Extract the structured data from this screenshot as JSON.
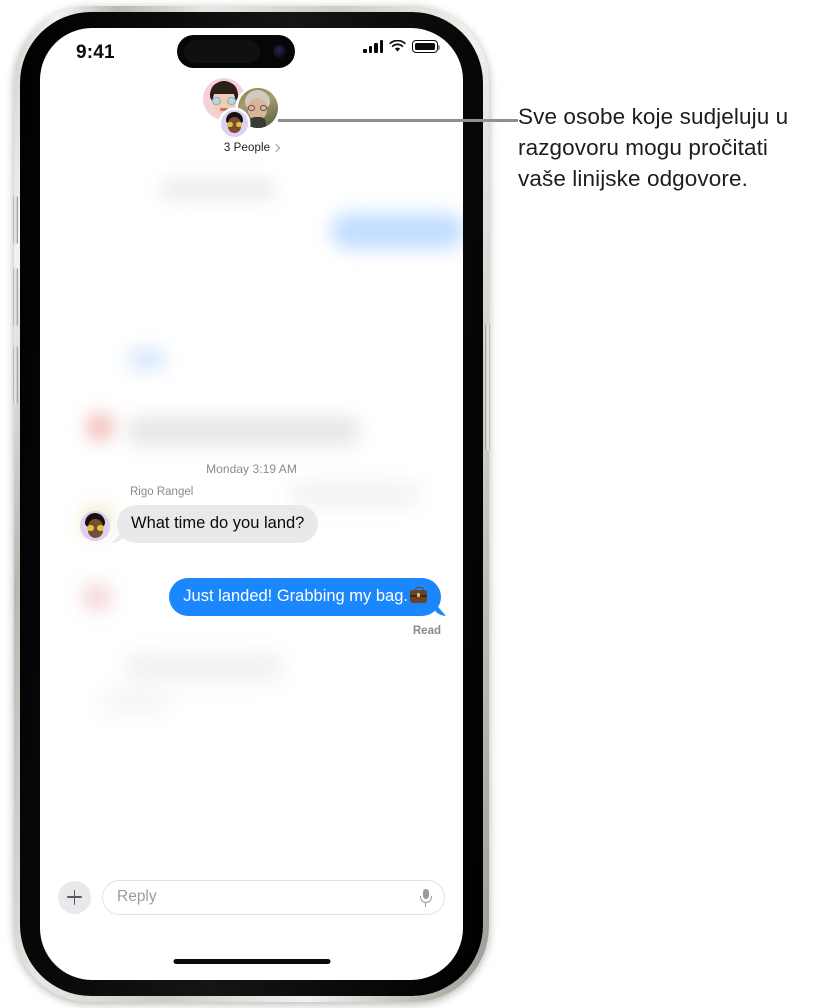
{
  "status_bar": {
    "time": "9:41",
    "signal_icon": "cellular-signal-icon",
    "wifi_icon": "wifi-icon",
    "battery_icon": "battery-icon"
  },
  "conversation_header": {
    "participants_label": "3 People",
    "chevron_icon": "chevron-right-icon",
    "avatars": [
      {
        "name": "avatar-memoji-pink",
        "color": "#f7cfd9"
      },
      {
        "name": "avatar-photo-person",
        "color": "#8b8348"
      },
      {
        "name": "avatar-memoji-purple",
        "color": "#ddd0f0"
      }
    ]
  },
  "conversation": {
    "timestamp": "Monday 3:19 AM",
    "messages": [
      {
        "sender": "Rigo Rangel",
        "text": "What time do you land?",
        "direction": "received",
        "bubble_color": "#e9e9eb"
      },
      {
        "sender": "",
        "text": "Just landed! Grabbing my bag.",
        "emoji": "briefcase-emoji",
        "direction": "sent",
        "bubble_color": "#1b87fd"
      }
    ],
    "read_receipt": "Read"
  },
  "input_bar": {
    "add_label": "+",
    "reply_placeholder": "Reply",
    "mic_icon": "microphone-icon",
    "plus_icon": "plus-icon"
  },
  "callout": {
    "text": "Sve osobe koje sudjeluju u razgovoru mogu pročitati vaše linijske odgovore."
  },
  "colors": {
    "accent_blue": "#1b87fd",
    "bubble_gray": "#e9e9eb",
    "secondary_text": "#8a8a8e"
  }
}
